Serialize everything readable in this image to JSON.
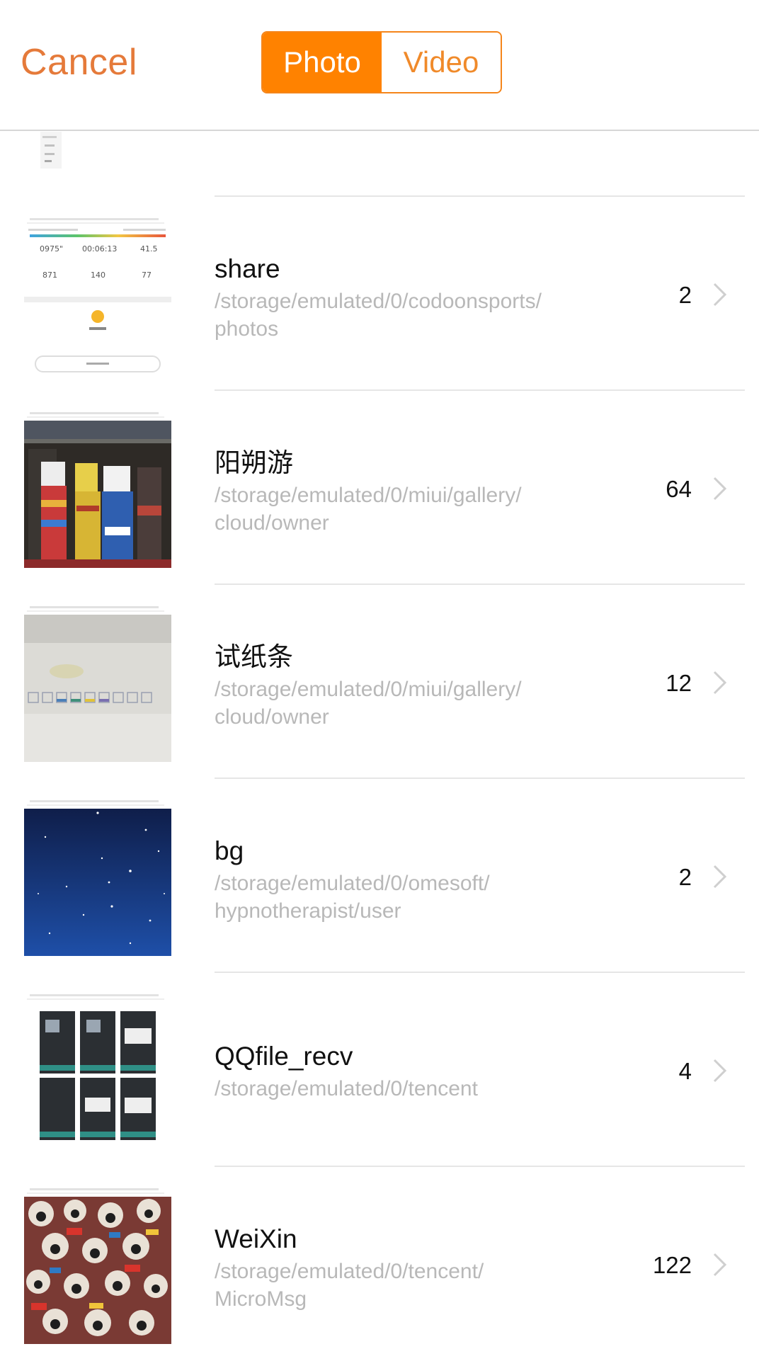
{
  "header": {
    "cancel_label": "Cancel",
    "tabs": [
      {
        "label": "Photo",
        "active": true
      },
      {
        "label": "Video",
        "active": false
      }
    ]
  },
  "colors": {
    "accent": "#ff8200",
    "cancel_text": "#e57a3a",
    "path_text": "#b8b8b8"
  },
  "albums": [
    {
      "name": "share",
      "path_line1": "/storage/emulated/0/codoonsports/",
      "path_line2": "photos",
      "count": "2",
      "thumb": "sports-screenshot"
    },
    {
      "name": "阳朔游",
      "path_line1": "/storage/emulated/0/miui/gallery/",
      "path_line2": "cloud/owner",
      "count": "64",
      "thumb": "clothing-photo"
    },
    {
      "name": "试纸条",
      "path_line1": "/storage/emulated/0/miui/gallery/",
      "path_line2": "cloud/owner",
      "count": "12",
      "thumb": "test-strip-photo"
    },
    {
      "name": "bg",
      "path_line1": "/storage/emulated/0/omesoft/",
      "path_line2": "hypnotherapist/user",
      "count": "2",
      "thumb": "starry-sky"
    },
    {
      "name": "QQfile_recv",
      "path_line1": "/storage/emulated/0/tencent",
      "path_line2": "",
      "count": "4",
      "thumb": "app-screens-grid"
    },
    {
      "name": "WeiXin",
      "path_line1": "/storage/emulated/0/tencent/",
      "path_line2": "MicroMsg",
      "count": "122",
      "thumb": "pug-collage"
    }
  ]
}
